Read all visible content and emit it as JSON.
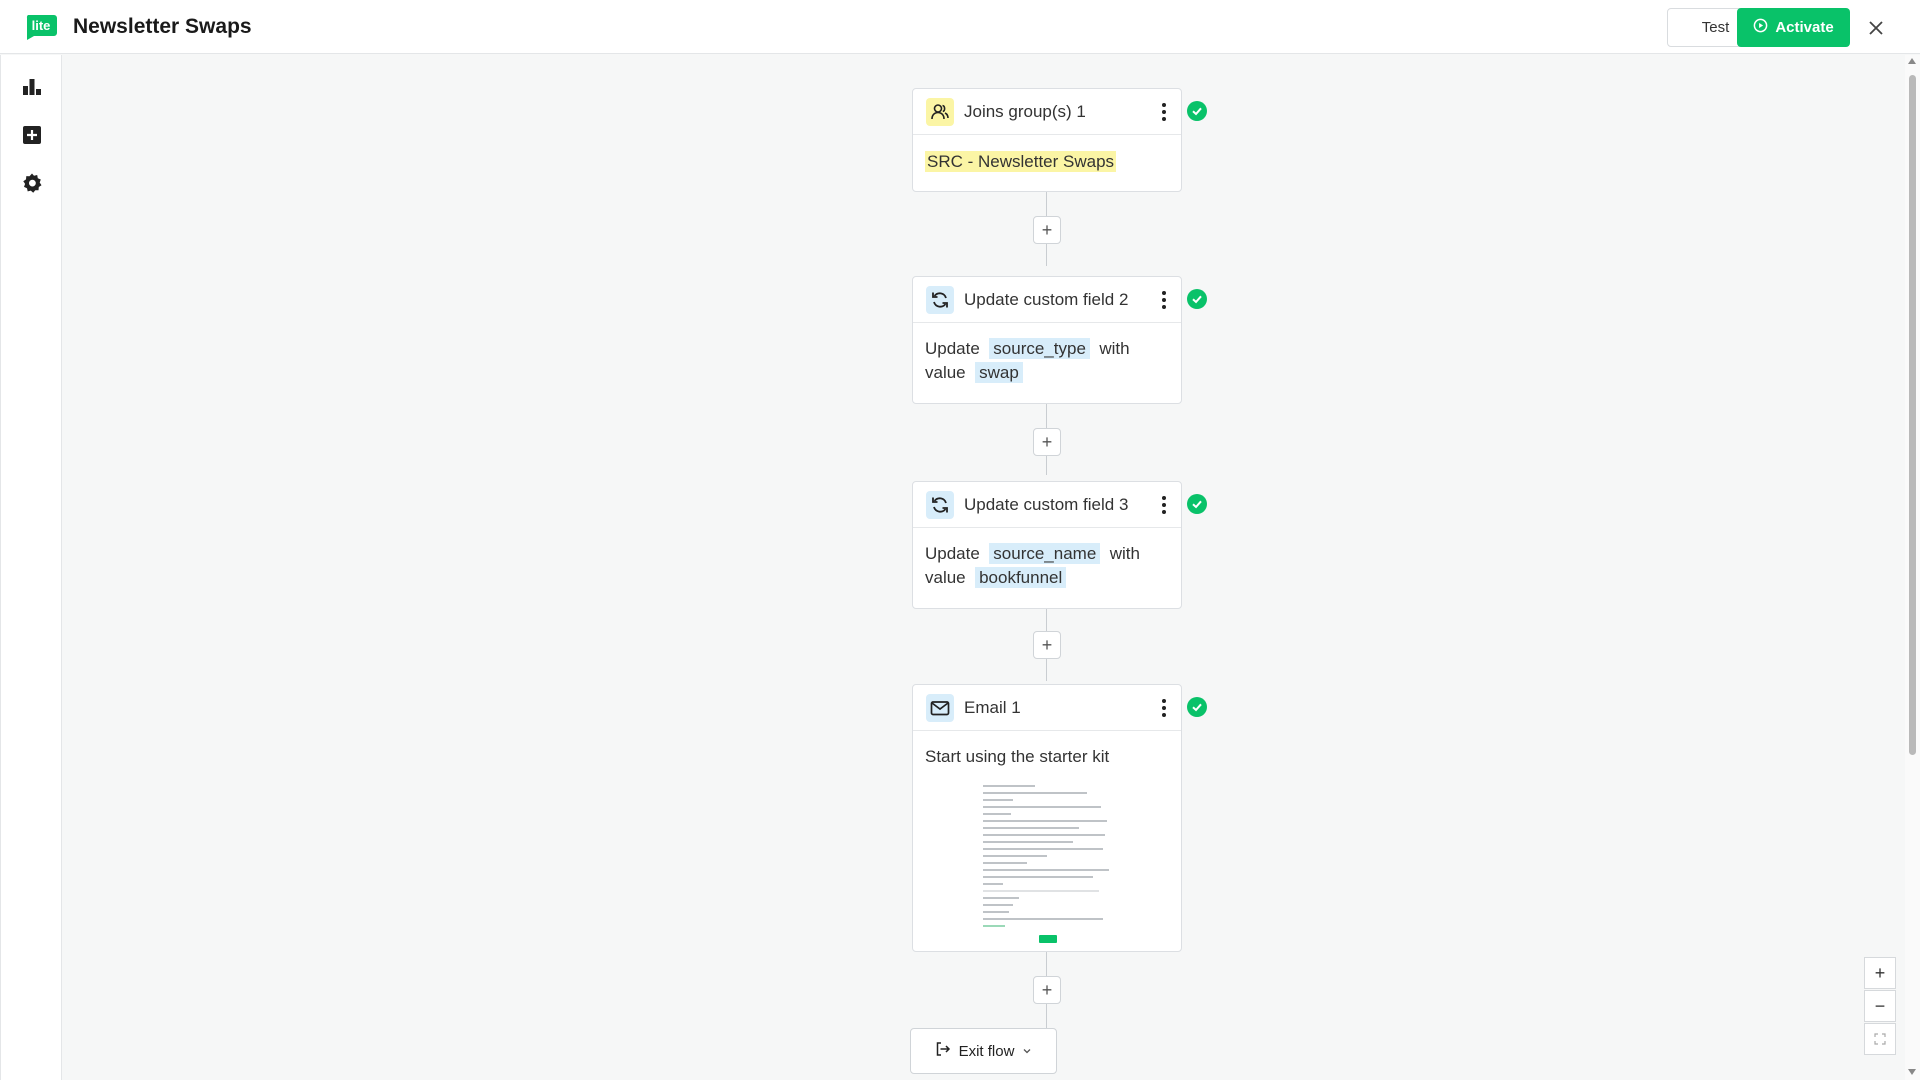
{
  "header": {
    "logo_text": "lite",
    "title": "Newsletter Swaps",
    "test_label": "Test",
    "activate_label": "Activate"
  },
  "sidebar": {
    "items": [
      {
        "icon": "reports-icon"
      },
      {
        "icon": "add-icon"
      },
      {
        "icon": "settings-icon"
      }
    ]
  },
  "flow": {
    "nodes": [
      {
        "title": "Joins group(s) 1",
        "icon": "users-icon",
        "body": {
          "value": "SRC - Newsletter Swaps"
        },
        "status": "complete"
      },
      {
        "title": "Update custom field 2",
        "icon": "refresh-icon",
        "body": {
          "prefix": "Update",
          "field": "source_type",
          "mid": "with",
          "mid2": "value",
          "value": "swap"
        },
        "status": "complete"
      },
      {
        "title": "Update custom field 3",
        "icon": "refresh-icon",
        "body": {
          "prefix": "Update",
          "field": "source_name",
          "mid": "with",
          "mid2": "value",
          "value": "bookfunnel"
        },
        "status": "complete"
      },
      {
        "title": "Email 1",
        "icon": "mail-icon",
        "body": {
          "subject": "Start using the starter kit"
        },
        "status": "complete"
      }
    ],
    "exit_label": "Exit flow"
  },
  "zoom": {
    "in_label": "+",
    "out_label": "−"
  },
  "colors": {
    "accent": "#09c269",
    "yellow_chip": "#fbf5a5",
    "blue_chip": "#d8edfa"
  }
}
